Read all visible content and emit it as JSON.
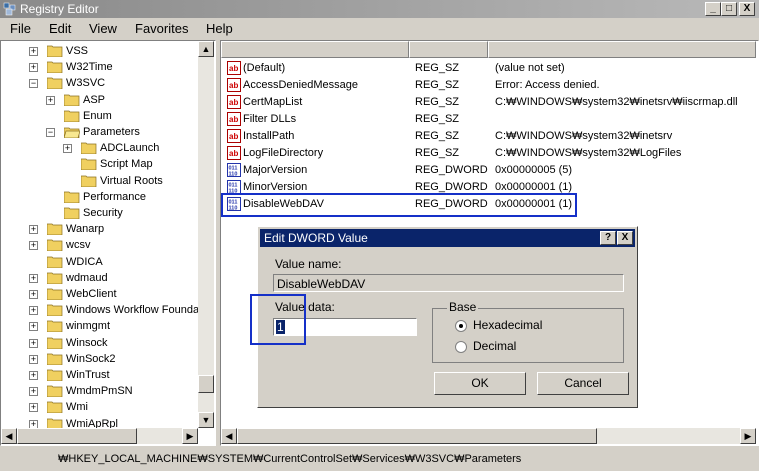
{
  "window": {
    "title": "Registry Editor",
    "controls": [
      "_",
      "□",
      "X"
    ]
  },
  "menu": [
    "File",
    "Edit",
    "View",
    "Favorites",
    "Help"
  ],
  "tree": [
    {
      "label": "VSS",
      "level": 0,
      "exp": "+"
    },
    {
      "label": "W32Time",
      "level": 0,
      "exp": "+"
    },
    {
      "label": "W3SVC",
      "level": 0,
      "exp": "-"
    },
    {
      "label": "ASP",
      "level": 1,
      "exp": "+"
    },
    {
      "label": "Enum",
      "level": 1,
      "exp": ""
    },
    {
      "label": "Parameters",
      "level": 1,
      "exp": "-",
      "open": true
    },
    {
      "label": "ADCLaunch",
      "level": 2,
      "exp": "+"
    },
    {
      "label": "Script Map",
      "level": 2,
      "exp": ""
    },
    {
      "label": "Virtual Roots",
      "level": 2,
      "exp": ""
    },
    {
      "label": "Performance",
      "level": 1,
      "exp": ""
    },
    {
      "label": "Security",
      "level": 1,
      "exp": ""
    },
    {
      "label": "Wanarp",
      "level": 0,
      "exp": "+"
    },
    {
      "label": "wcsv",
      "level": 0,
      "exp": "+"
    },
    {
      "label": "WDICA",
      "level": 0,
      "exp": ""
    },
    {
      "label": "wdmaud",
      "level": 0,
      "exp": "+"
    },
    {
      "label": "WebClient",
      "level": 0,
      "exp": "+"
    },
    {
      "label": "Windows Workflow Foundat",
      "level": 0,
      "exp": "+"
    },
    {
      "label": "winmgmt",
      "level": 0,
      "exp": "+"
    },
    {
      "label": "Winsock",
      "level": 0,
      "exp": "+"
    },
    {
      "label": "WinSock2",
      "level": 0,
      "exp": "+"
    },
    {
      "label": "WinTrust",
      "level": 0,
      "exp": "+"
    },
    {
      "label": "WmdmPmSN",
      "level": 0,
      "exp": "+"
    },
    {
      "label": "Wmi",
      "level": 0,
      "exp": "+"
    },
    {
      "label": "WmiApRpl",
      "level": 0,
      "exp": "+"
    }
  ],
  "values": [
    {
      "name": "(Default)",
      "type": "REG_SZ",
      "data": "(value not set)",
      "icon": "ab"
    },
    {
      "name": "AccessDeniedMessage",
      "type": "REG_SZ",
      "data": "Error: Access denied.",
      "icon": "ab"
    },
    {
      "name": "CertMapList",
      "type": "REG_SZ",
      "data": "C:₩WINDOWS₩system32₩inetsrv₩iiscrmap.dll",
      "icon": "ab"
    },
    {
      "name": "Filter DLLs",
      "type": "REG_SZ",
      "data": "",
      "icon": "ab"
    },
    {
      "name": "InstallPath",
      "type": "REG_SZ",
      "data": "C:₩WINDOWS₩system32₩inetsrv",
      "icon": "ab"
    },
    {
      "name": "LogFileDirectory",
      "type": "REG_SZ",
      "data": "C:₩WINDOWS₩system32₩LogFiles",
      "icon": "ab"
    },
    {
      "name": "MajorVersion",
      "type": "REG_DWORD",
      "data": "0x00000005 (5)",
      "icon": "dword"
    },
    {
      "name": "MinorVersion",
      "type": "REG_DWORD",
      "data": "0x00000001 (1)",
      "icon": "dword"
    },
    {
      "name": "DisableWebDAV",
      "type": "REG_DWORD",
      "data": "0x00000001 (1)",
      "icon": "dword"
    }
  ],
  "status": {
    "path": "₩HKEY_LOCAL_MACHINE₩SYSTEM₩CurrentControlSet₩Services₩W3SVC₩Parameters"
  },
  "dialog": {
    "title": "Edit DWORD Value",
    "help": "?",
    "close": "X",
    "value_name_label": "Value name:",
    "value_name": "DisableWebDAV",
    "value_data_label": "Value data:",
    "value_data": "1",
    "base_label": "Base",
    "hex_label": "Hexadecimal",
    "dec_label": "Decimal",
    "selected_base": "Hexadecimal",
    "ok": "OK",
    "cancel": "Cancel"
  },
  "colors": {
    "highlight": "#1530c8",
    "dialog_title": "#0a246a",
    "folder": "#f0d060"
  }
}
